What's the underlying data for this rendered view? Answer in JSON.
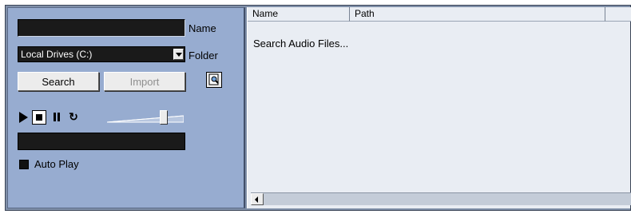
{
  "search_panel": {
    "name_label": "Name",
    "name_value": "",
    "folder_label": "Folder",
    "folder_value": "Local Drives (C:)",
    "search_button": "Search",
    "import_button": "Import",
    "auto_play_label": "Auto Play",
    "auto_play_checked": true,
    "volume_level": 0.8
  },
  "results": {
    "columns": [
      "Name",
      "Path",
      ""
    ],
    "status_text": "Search Audio Files..."
  }
}
